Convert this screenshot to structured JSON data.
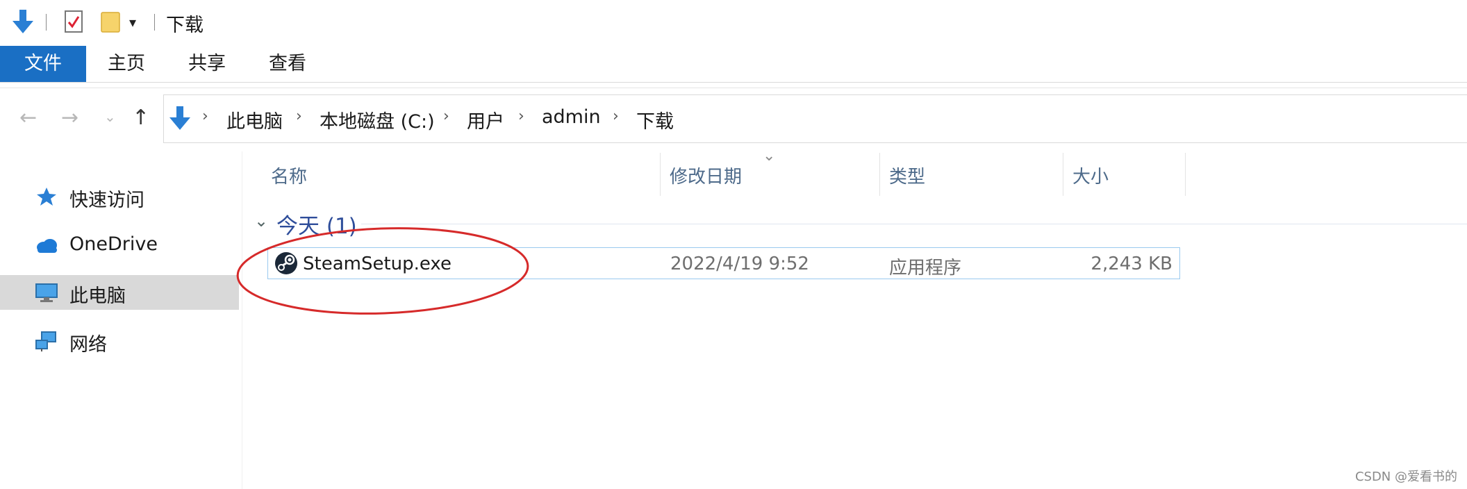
{
  "window": {
    "title": "下载"
  },
  "ribbon": {
    "tabs": [
      {
        "label": "文件"
      },
      {
        "label": "主页"
      },
      {
        "label": "共享"
      },
      {
        "label": "查看"
      }
    ]
  },
  "address_bar": {
    "breadcrumbs": [
      "此电脑",
      "本地磁盘 (C:)",
      "用户",
      "admin",
      "下载"
    ]
  },
  "nav_pane": {
    "items": [
      {
        "label": "快速访问",
        "icon": "star-icon"
      },
      {
        "label": "OneDrive",
        "icon": "cloud-icon"
      },
      {
        "label": "此电脑",
        "icon": "monitor-icon",
        "selected": true
      },
      {
        "label": "网络",
        "icon": "network-icon"
      }
    ]
  },
  "file_list": {
    "columns": [
      "名称",
      "修改日期",
      "类型",
      "大小"
    ],
    "group": {
      "label": "今天 (1)"
    },
    "rows": [
      {
        "name": "SteamSetup.exe",
        "date": "2022/4/19 9:52",
        "type": "应用程序",
        "size": "2,243 KB",
        "icon": "steam-icon"
      }
    ]
  },
  "colors": {
    "accent": "#1a6fc4",
    "annotation": "#d62a2a"
  },
  "watermark": "CSDN @爱看书的"
}
